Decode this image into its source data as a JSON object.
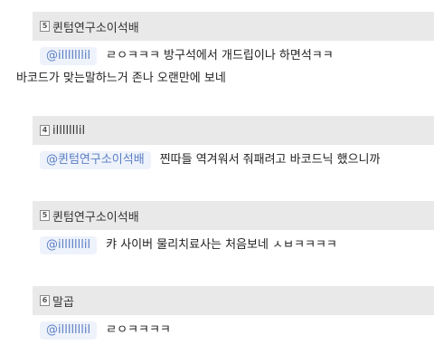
{
  "comments": [
    {
      "level": "5",
      "author": "퀸텀연구소이석배",
      "mention": "@illlllllil",
      "text": "ㄹㅇㅋㅋㅋ 방구석에서 개드립이나 하면석ㅋㅋ",
      "text_cont": "바코드가 맞는말하느거 존나 오랜만에 보네"
    },
    {
      "level": "4",
      "author": "illlllllil",
      "mention": "@퀸텀연구소이석배",
      "text": "찐따들 역겨워서 줘패려고 바코드닉 했으니까"
    },
    {
      "level": "5",
      "author": "퀸텀연구소이석배",
      "mention": "@illlllllil",
      "text": "캬 사이버 물리치료사는 처음보네 ㅅㅂㅋㅋㅋㅋ"
    },
    {
      "level": "6",
      "author": "말곱",
      "mention": "@illlllllil",
      "text": "ㄹㅇㅋㅋㅋㅋ"
    }
  ]
}
